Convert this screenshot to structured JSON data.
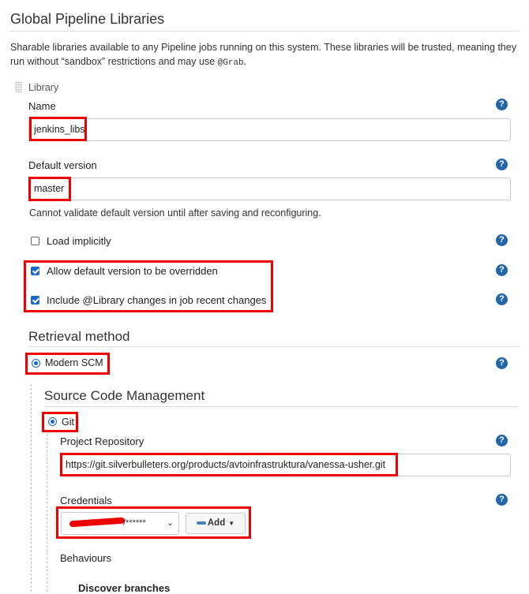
{
  "header": {
    "title": "Global Pipeline Libraries",
    "description_1": "Sharable libraries available to any Pipeline jobs running on this system. These libraries will be trusted, meaning they",
    "description_2_prefix": "run without “sandbox” restrictions and may use ",
    "description_2_code": "@Grab",
    "description_2_suffix": "."
  },
  "library": {
    "handle_label": "Library",
    "name_label": "Name",
    "name_value": "jenkins_libs",
    "default_version_label": "Default version",
    "default_version_value": "master",
    "default_version_note": "Cannot validate default version until after saving and reconfiguring.",
    "load_implicitly_label": "Load implicitly",
    "load_implicitly_checked": false,
    "allow_override_label": "Allow default version to be overridden",
    "allow_override_checked": true,
    "include_changes_label": "Include @Library changes in job recent changes",
    "include_changes_checked": true
  },
  "retrieval": {
    "title": "Retrieval method",
    "modern_scm_label": "Modern SCM",
    "modern_scm_selected": true
  },
  "scm": {
    "title": "Source Code Management",
    "git_label": "Git",
    "git_selected": true,
    "project_repo_label": "Project Repository",
    "project_repo_value": "https://git.silverbulleters.org/products/avtoinfrastruktura/vanessa-usher.git",
    "credentials_label": "Credentials",
    "credentials_value": "/******",
    "add_button_label": "Add",
    "behaviours_label": "Behaviours",
    "discover_branches_label": "Discover branches"
  },
  "help_glyph": "?",
  "colors": {
    "highlight": "#e00000",
    "help_icon": "#2366a8",
    "checkbox_accent": "#1a66d2"
  }
}
